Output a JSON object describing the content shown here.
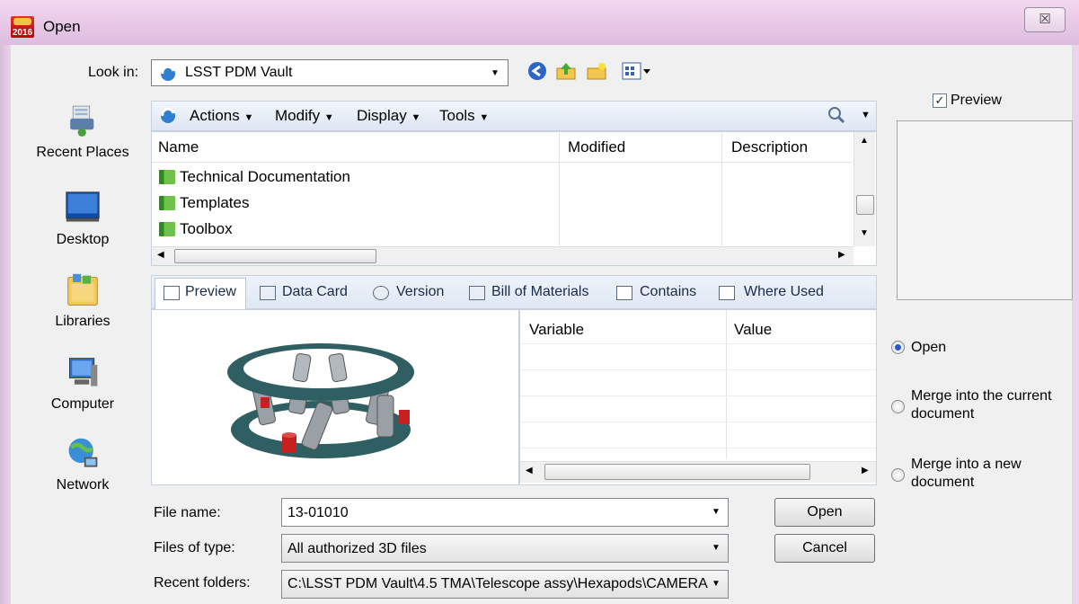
{
  "window": {
    "title": "Open",
    "app_badge": "2016",
    "close_glyph": "☒"
  },
  "places": [
    {
      "label": "Recent Places",
      "icon": "recent-places-icon"
    },
    {
      "label": "Desktop",
      "icon": "desktop-icon"
    },
    {
      "label": "Libraries",
      "icon": "libraries-icon"
    },
    {
      "label": "Computer",
      "icon": "computer-icon"
    },
    {
      "label": "Network",
      "icon": "network-icon"
    }
  ],
  "lookin": {
    "label": "Look in:",
    "value": "LSST PDM Vault",
    "toolbar_icons": [
      "back-icon",
      "up-folder-icon",
      "new-folder-icon",
      "view-menu-icon"
    ]
  },
  "vault_menu": {
    "items": [
      "Actions",
      "Modify",
      "Display",
      "Tools"
    ],
    "search_icon": "search-icon"
  },
  "file_list": {
    "columns": [
      "Name",
      "Modified",
      "Description"
    ],
    "rows": [
      {
        "name": "Technical Documentation",
        "icon": "folder-icon"
      },
      {
        "name": "Templates",
        "icon": "folder-icon"
      },
      {
        "name": "Toolbox",
        "icon": "folder-icon"
      }
    ]
  },
  "tabs": [
    {
      "label": "Preview",
      "icon": "preview-icon",
      "active": true
    },
    {
      "label": "Data Card",
      "icon": "data-card-icon"
    },
    {
      "label": "Version",
      "icon": "version-icon"
    },
    {
      "label": "Bill of Materials",
      "icon": "bom-icon"
    },
    {
      "label": "Contains",
      "icon": "contains-icon"
    },
    {
      "label": "Where Used",
      "icon": "where-used-icon"
    }
  ],
  "variables_grid": {
    "columns": [
      "Variable",
      "Value"
    ]
  },
  "preview_option": {
    "label": "Preview",
    "checked": true
  },
  "open_mode": {
    "selected": "Open",
    "options": [
      "Open",
      "Merge into the current document",
      "Merge into a new document"
    ],
    "option_lines": [
      [
        "Open"
      ],
      [
        "Merge into the current",
        "document"
      ],
      [
        "Merge into a new",
        "document"
      ]
    ]
  },
  "bottom": {
    "file_name_label": "File name:",
    "file_name_value": "13-01010",
    "files_of_type_label": "Files of type:",
    "files_of_type_value": "All authorized 3D files",
    "recent_folders_label": "Recent folders:",
    "recent_folders_value": "C:\\LSST PDM Vault\\4.5 TMA\\Telescope assy\\Hexapods\\CAMERA",
    "open_button": "Open",
    "cancel_button": "Cancel"
  },
  "colors": {
    "title_bar": "#e6c7e6",
    "toolbar_bg": "#dde6f2",
    "model_ring": "#2f5f63",
    "model_accent": "#c62020"
  }
}
